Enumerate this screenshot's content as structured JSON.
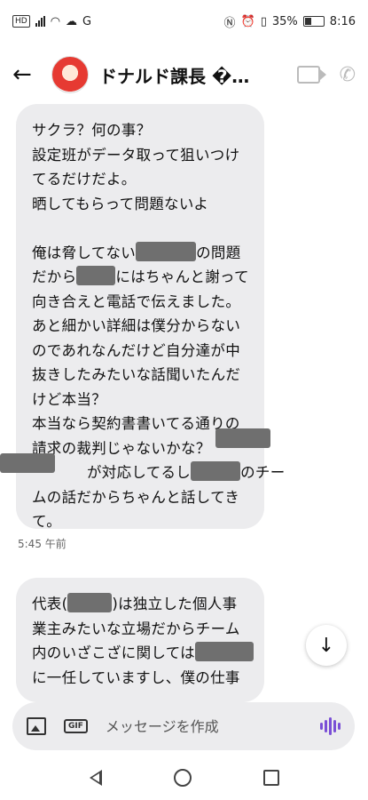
{
  "status_bar": {
    "hd": "HD",
    "network": "G",
    "battery": "35%",
    "time": "8:16"
  },
  "header": {
    "title": "ドナルド課長 �...",
    "icons": [
      "back-arrow-icon",
      "video-call-icon",
      "phone-icon"
    ]
  },
  "messages": [
    {
      "lines": [
        "サクラ？何の事？",
        "設定班がデータ取って狙いつけ",
        "てるだけだよ。",
        "晒してもらって問題ないよ",
        "",
        "俺は脅してない",
        "の問題",
        "だから",
        "にはちゃんと謝って",
        "向き合えと電話で伝えました。",
        "あと細かい詳細は僕分からない",
        "のであれなんだけど自分達が中",
        "抜きしたみたいな話聞いたんだ",
        "けど本当？",
        "本当なら契約書書いてる通りの",
        "請求の裁判じゃないかな？",
        "が対応してるし",
        "のチー",
        "ムの話だからちゃんと話してき",
        "て。"
      ]
    },
    {
      "time": "5:45 午前"
    },
    {
      "lines": [
        "代表(",
        ")は独立した個人事",
        "業主みたいな立場だからチーム",
        "内のいざこざに関しては",
        "に一任していますし、僕の仕事"
      ]
    }
  ],
  "composer": {
    "placeholder": "メッセージを作成"
  },
  "nav": [
    "nav-back-icon",
    "nav-home-icon",
    "nav-recent-icon"
  ]
}
